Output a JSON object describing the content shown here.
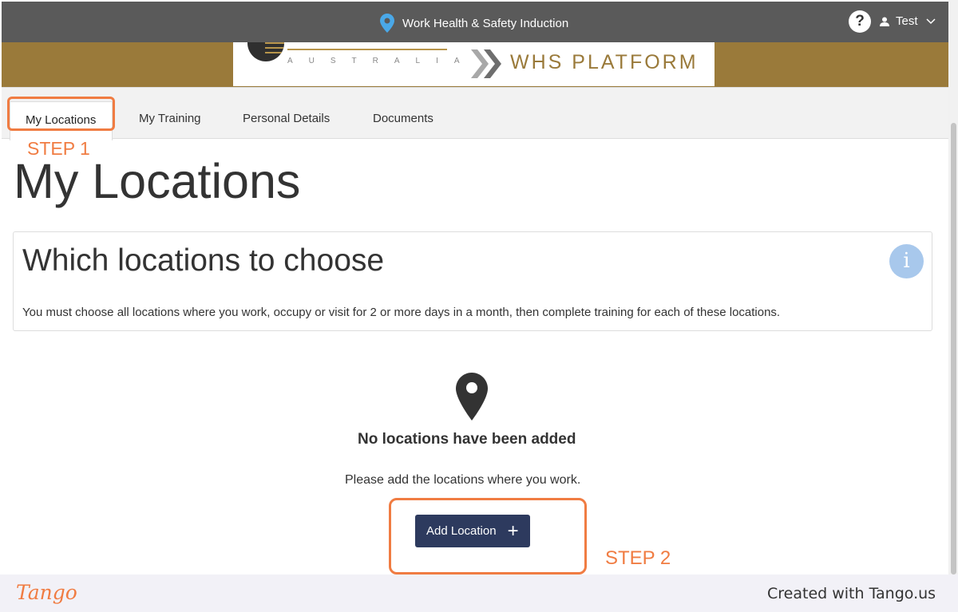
{
  "header": {
    "title": "Work Health & Safety Induction",
    "help_label": "?",
    "user_name": "Test"
  },
  "banner": {
    "brand_line": "AUSTRALIA",
    "platform_name": "WHS PLATFORM"
  },
  "tabs": [
    {
      "label": "My Locations",
      "active": true
    },
    {
      "label": "My Training"
    },
    {
      "label": "Personal Details"
    },
    {
      "label": "Documents"
    }
  ],
  "page": {
    "title": "My Locations"
  },
  "info_panel": {
    "title": "Which locations to choose",
    "icon_label": "i",
    "text": "You must choose all locations where you work, occupy or visit for 2 or more days in a month, then complete training for each of these locations."
  },
  "empty_state": {
    "title": "No locations have been added",
    "text": "Please add the locations where you work.",
    "button_label": "Add Location",
    "button_icon": "+"
  },
  "annotations": {
    "step1": "STEP 1",
    "step2": "STEP 2",
    "color": "#f07c42"
  },
  "footer": {
    "logo": "Tango",
    "credit": "Created with Tango.us"
  },
  "colors": {
    "topbar": "#5a5a5a",
    "banner": "#9a7a3a",
    "button": "#2d3a5e",
    "info_icon": "#a8c8ec"
  }
}
